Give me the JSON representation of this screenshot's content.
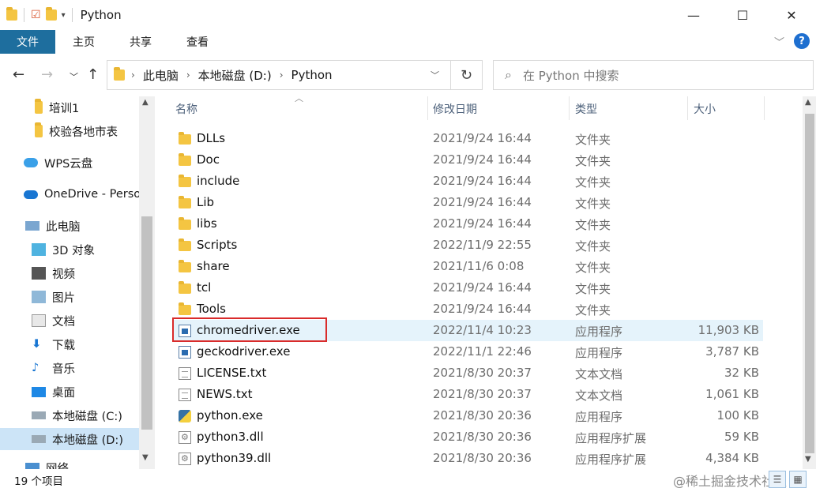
{
  "window": {
    "title": "Python",
    "minimize": "—",
    "maximize": "☐",
    "close": "✕"
  },
  "ribbon": {
    "tabs": [
      "文件",
      "主页",
      "共享",
      "查看"
    ],
    "expand_icon": "chevron-down-icon",
    "help": "?"
  },
  "address": {
    "crumbs": [
      "此电脑",
      "本地磁盘 (D:)",
      "Python"
    ],
    "search_placeholder": "在 Python 中搜索"
  },
  "nav": {
    "items": [
      {
        "label": "培训1",
        "icon": "folder-icon"
      },
      {
        "label": "校验各地市表",
        "icon": "folder-icon"
      },
      {
        "label": "WPS云盘",
        "icon": "cloud-icon"
      },
      {
        "label": "OneDrive - Perso",
        "icon": "onedrive-icon"
      },
      {
        "label": "此电脑",
        "icon": "pc-icon"
      },
      {
        "label": "3D 对象",
        "icon": "cube-icon"
      },
      {
        "label": "视频",
        "icon": "video-icon"
      },
      {
        "label": "图片",
        "icon": "picture-icon"
      },
      {
        "label": "文档",
        "icon": "document-icon"
      },
      {
        "label": "下载",
        "icon": "download-icon"
      },
      {
        "label": "音乐",
        "icon": "music-icon"
      },
      {
        "label": "桌面",
        "icon": "desktop-icon"
      },
      {
        "label": "本地磁盘 (C:)",
        "icon": "drive-icon"
      },
      {
        "label": "本地磁盘 (D:)",
        "icon": "drive-icon"
      },
      {
        "label": "网络",
        "icon": "network-icon"
      }
    ]
  },
  "list": {
    "columns": [
      "名称",
      "修改日期",
      "类型",
      "大小"
    ],
    "rows": [
      {
        "name": "DLLs",
        "date": "2021/9/24 16:44",
        "type": "文件夹",
        "size": "",
        "icon": "folder-icon"
      },
      {
        "name": "Doc",
        "date": "2021/9/24 16:44",
        "type": "文件夹",
        "size": "",
        "icon": "folder-icon"
      },
      {
        "name": "include",
        "date": "2021/9/24 16:44",
        "type": "文件夹",
        "size": "",
        "icon": "folder-icon"
      },
      {
        "name": "Lib",
        "date": "2021/9/24 16:44",
        "type": "文件夹",
        "size": "",
        "icon": "folder-icon"
      },
      {
        "name": "libs",
        "date": "2021/9/24 16:44",
        "type": "文件夹",
        "size": "",
        "icon": "folder-icon"
      },
      {
        "name": "Scripts",
        "date": "2022/11/9 22:55",
        "type": "文件夹",
        "size": "",
        "icon": "folder-icon"
      },
      {
        "name": "share",
        "date": "2021/11/6 0:08",
        "type": "文件夹",
        "size": "",
        "icon": "folder-icon"
      },
      {
        "name": "tcl",
        "date": "2021/9/24 16:44",
        "type": "文件夹",
        "size": "",
        "icon": "folder-icon"
      },
      {
        "name": "Tools",
        "date": "2021/9/24 16:44",
        "type": "文件夹",
        "size": "",
        "icon": "folder-icon"
      },
      {
        "name": "chromedriver.exe",
        "date": "2022/11/4 10:23",
        "type": "应用程序",
        "size": "11,903 KB",
        "icon": "exe-icon",
        "selected": true
      },
      {
        "name": "geckodriver.exe",
        "date": "2022/11/1 22:46",
        "type": "应用程序",
        "size": "3,787 KB",
        "icon": "exe-icon"
      },
      {
        "name": "LICENSE.txt",
        "date": "2021/8/30 20:37",
        "type": "文本文档",
        "size": "32 KB",
        "icon": "text-file-icon"
      },
      {
        "name": "NEWS.txt",
        "date": "2021/8/30 20:37",
        "type": "文本文档",
        "size": "1,061 KB",
        "icon": "text-file-icon"
      },
      {
        "name": "python.exe",
        "date": "2021/8/30 20:36",
        "type": "应用程序",
        "size": "100 KB",
        "icon": "python-icon"
      },
      {
        "name": "python3.dll",
        "date": "2021/8/30 20:36",
        "type": "应用程序扩展",
        "size": "59 KB",
        "icon": "dll-icon"
      },
      {
        "name": "python39.dll",
        "date": "2021/8/30 20:36",
        "type": "应用程序扩展",
        "size": "4,384 KB",
        "icon": "dll-icon"
      }
    ]
  },
  "status": {
    "count": "19 个项目",
    "watermark": "@稀土掘金技术社区"
  },
  "colors": {
    "ribbon_active": "#1e6e9e",
    "selection": "#cce4f7",
    "highlight_box": "#d92b2b"
  }
}
